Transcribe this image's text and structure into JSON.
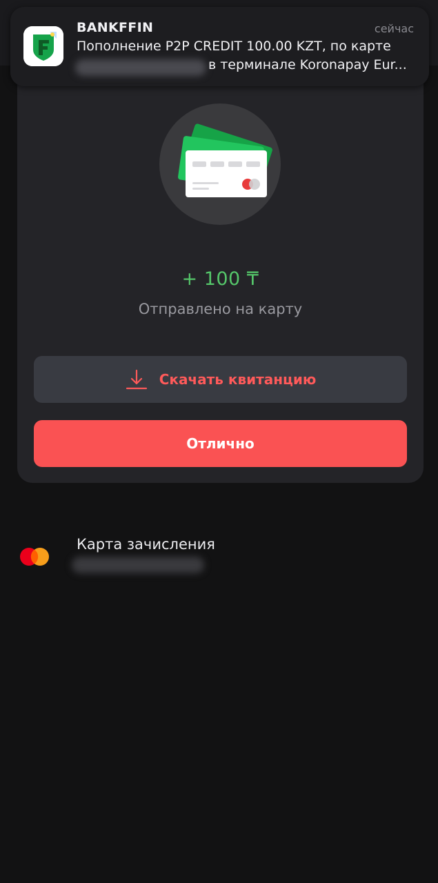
{
  "notification": {
    "app_name": "BANKFFIN",
    "time": "сейчас",
    "message_line1": "Пополнение P2P CREDIT 100.00 KZT, по карте",
    "message_line2": "в терминале Koronapay Eur..."
  },
  "result": {
    "amount": "+ 100 ₸",
    "status_text": "Отправлено на карту",
    "download_label": "Скачать квитанцию",
    "ok_label": "Отлично"
  },
  "card": {
    "title": "Карта зачисления"
  },
  "icons": {
    "download": "download-icon",
    "card_brand": "mastercard-logo"
  },
  "colors": {
    "background": "#121213",
    "sheet": "#242428",
    "amount_green": "#55c66a",
    "accent_red": "#fa5253",
    "download_button_bg": "#393b42",
    "download_text": "#ff5a5a"
  }
}
